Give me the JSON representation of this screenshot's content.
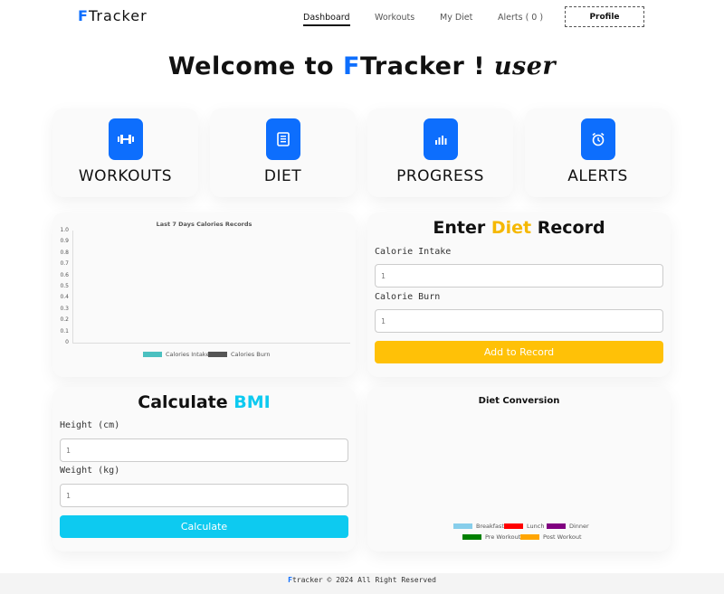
{
  "nav": {
    "brand_first": "F",
    "brand_rest": "Tracker",
    "links": [
      "Dashboard",
      "Workouts",
      "My Diet",
      "Alerts ( 0 )"
    ],
    "profile_label": "Profile"
  },
  "hero": {
    "prefix": "Welcome to ",
    "brand_first": "F",
    "brand_rest": "Tracker ! ",
    "user": "user"
  },
  "tiles": [
    {
      "label": "WORKOUTS",
      "icon": "dumbbell-icon"
    },
    {
      "label": "DIET",
      "icon": "book-icon"
    },
    {
      "label": "PROGRESS",
      "icon": "bar-chart-icon"
    },
    {
      "label": "ALERTS",
      "icon": "alarm-clock-icon"
    }
  ],
  "calories_chart": {
    "title": "Last 7 Days Calories Records",
    "yticks": [
      "1.0",
      "0.9",
      "0.8",
      "0.7",
      "0.6",
      "0.5",
      "0.4",
      "0.3",
      "0.2",
      "0.1",
      "0"
    ],
    "legend": [
      {
        "label": "Calories Intake",
        "color": "#4bc0c0"
      },
      {
        "label": "Calories Burn",
        "color": "#555555"
      }
    ]
  },
  "diet_form": {
    "title_prefix": "Enter ",
    "title_accent": "Diet",
    "title_suffix": " Record",
    "intake_label": "Calorie Intake",
    "intake_value": "1",
    "burn_label": "Calorie Burn",
    "burn_value": "1",
    "submit_label": "Add to Record",
    "accent_color": "#ffc107"
  },
  "bmi_form": {
    "title_prefix": "Calculate ",
    "title_accent": "BMI",
    "height_label": "Height (cm)",
    "height_value": "1",
    "weight_label": "Weight (kg)",
    "weight_value": "1",
    "submit_label": "Calculate",
    "accent_color": "#0dcaf0"
  },
  "diet_chart": {
    "title": "Diet Conversion",
    "legend": [
      {
        "label": "Breakfast",
        "color": "#87ceeb"
      },
      {
        "label": "Lunch",
        "color": "#ff0000"
      },
      {
        "label": "Dinner",
        "color": "#800080"
      },
      {
        "label": "Pre Workout",
        "color": "#008000"
      },
      {
        "label": "Post Workout",
        "color": "#ffa500"
      }
    ]
  },
  "footer": {
    "brand_first": "F",
    "text": "tracker © 2024 All Right Reserved"
  }
}
